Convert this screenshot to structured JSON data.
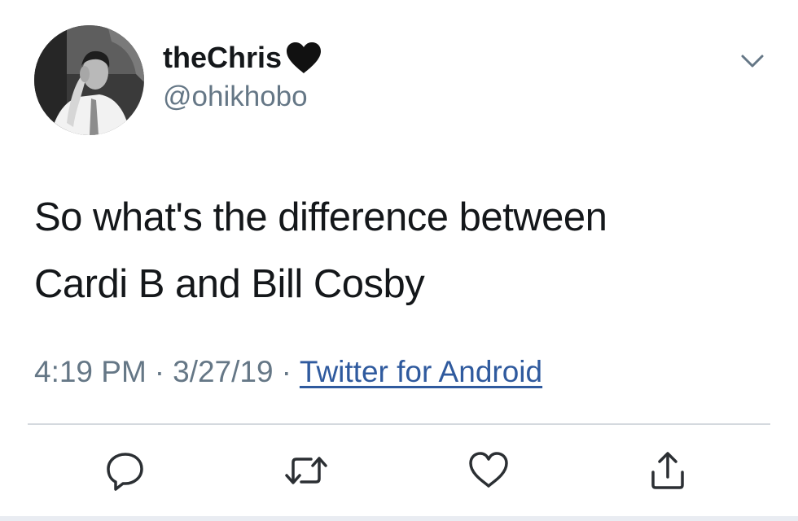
{
  "tweet": {
    "author": {
      "display_name": "theChris",
      "name_emoji": "black-heart-emoji",
      "handle": "@ohikhobo"
    },
    "text_lines": [
      "So what's the difference between",
      "Cardi B and Bill Cosby"
    ],
    "time": "4:19 PM",
    "separator": "·",
    "date": "3/27/19",
    "source": "Twitter for Android"
  },
  "actions": [
    "reply-icon",
    "retweet-icon",
    "like-icon",
    "share-icon"
  ],
  "colors": {
    "text": "#14171a",
    "secondary": "#657786",
    "link": "#2f5a9e",
    "divider": "#d4d9de"
  }
}
